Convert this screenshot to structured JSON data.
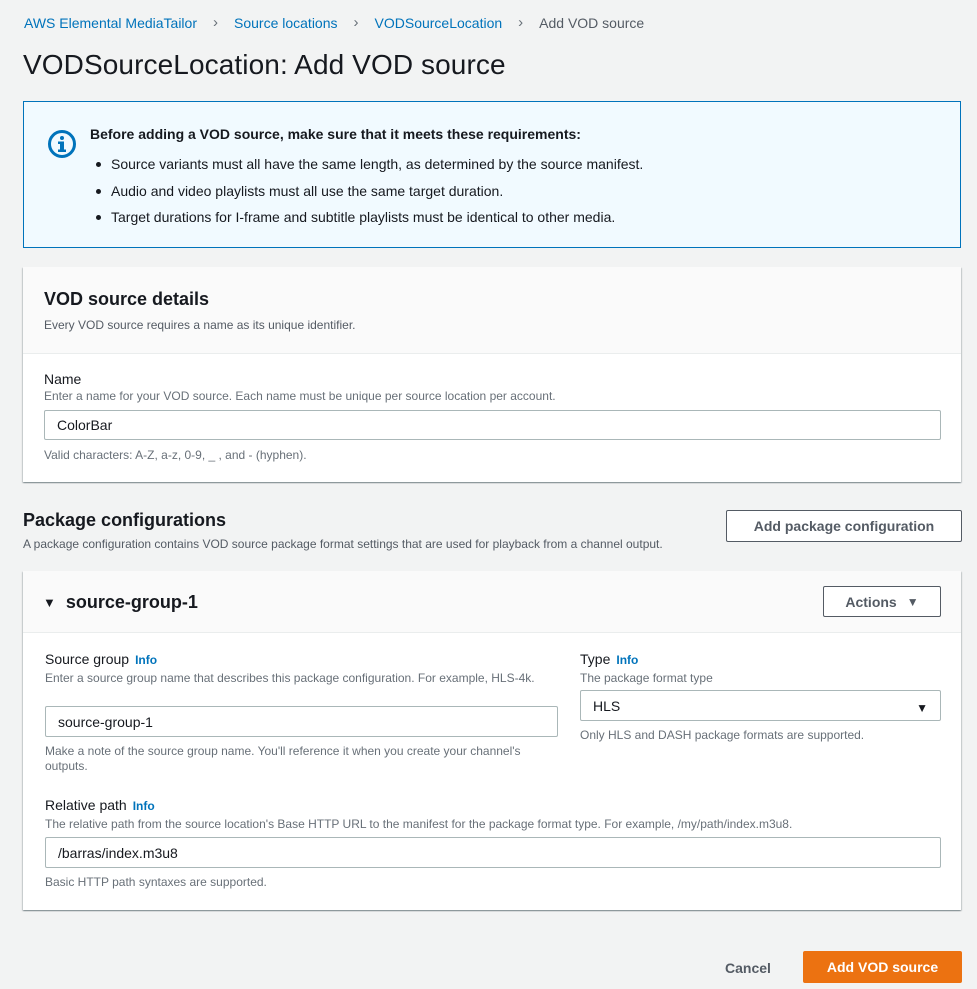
{
  "breadcrumb": {
    "items": [
      "AWS Elemental MediaTailor",
      "Source locations",
      "VODSourceLocation"
    ],
    "current": "Add VOD source"
  },
  "page_title": "VODSourceLocation: Add VOD source",
  "alert": {
    "heading": "Before adding a VOD source, make sure that it meets these requirements:",
    "items": [
      "Source variants must all have the same length, as determined by the source manifest.",
      "Audio and video playlists must all use the same target duration.",
      "Target durations for I-frame and subtitle playlists must be identical to other media."
    ]
  },
  "details": {
    "title": "VOD source details",
    "subtitle": "Every VOD source requires a name as its unique identifier.",
    "name": {
      "label": "Name",
      "description": "Enter a name for your VOD source. Each name must be unique per source location per account.",
      "value": "ColorBar",
      "constraint": "Valid characters: A-Z, a-z, 0-9, _ , and - (hyphen)."
    }
  },
  "package_configurations": {
    "title": "Package configurations",
    "subtitle": "A package configuration contains VOD source package format settings that are used for playback from a channel output.",
    "add_button": "Add package configuration",
    "group": {
      "title": "source-group-1",
      "actions_label": "Actions",
      "source_group": {
        "label": "Source group",
        "info": "Info",
        "description": "Enter a source group name that describes this package configuration. For example, HLS-4k.",
        "value": "source-group-1",
        "constraint": "Make a note of the source group name. You'll reference it when you create your channel's outputs."
      },
      "type": {
        "label": "Type",
        "info": "Info",
        "description": "The package format type",
        "value": "HLS",
        "constraint": "Only HLS and DASH package formats are supported."
      },
      "relative_path": {
        "label": "Relative path",
        "info": "Info",
        "description": "The relative path from the source location's Base HTTP URL to the manifest for the package format type. For example, /my/path/index.m3u8.",
        "value": "/barras/index.m3u8",
        "constraint": "Basic HTTP path syntaxes are supported."
      }
    }
  },
  "footer": {
    "cancel": "Cancel",
    "submit": "Add VOD source"
  },
  "colors": {
    "link": "#0073bb",
    "primary": "#ec7211",
    "info_bg": "#f1faff"
  }
}
